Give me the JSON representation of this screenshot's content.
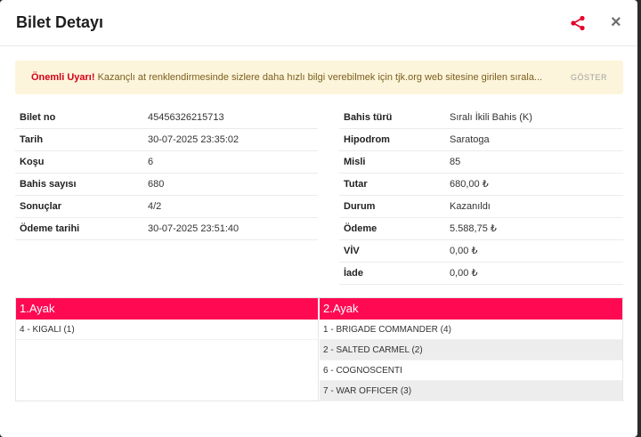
{
  "modal": {
    "title": "Bilet Detayı",
    "share_icon": "share-icon",
    "close_label": "×"
  },
  "warning": {
    "label": "Önemli Uyarı!",
    "text": "Kazançlı at renklendirmesinde sizlere daha hızlı bilgi verebilmek için tjk.org web sitesine girilen sırala...",
    "show_label": "GÖSTER",
    "bg_color": "#fdf5db"
  },
  "left_rows": [
    {
      "key": "Bilet no",
      "value": "45456326215713"
    },
    {
      "key": "Tarih",
      "value": "30-07-2025 23:35:02"
    },
    {
      "key": "Koşu",
      "value": "6"
    },
    {
      "key": "Bahis sayısı",
      "value": "680"
    },
    {
      "key": "Sonuçlar",
      "value": "4/2"
    },
    {
      "key": "Ödeme tarihi",
      "value": "30-07-2025 23:51:40"
    }
  ],
  "right_rows": [
    {
      "key": "Bahis türü",
      "value": "Sıralı İkili Bahis (K)"
    },
    {
      "key": "Hipodrom",
      "value": "Saratoga"
    },
    {
      "key": "Misli",
      "value": "85"
    },
    {
      "key": "Tutar",
      "value": "680,00 ₺"
    },
    {
      "key": "Durum",
      "value": "Kazanıldı"
    },
    {
      "key": "Ödeme",
      "value": "5.588,75 ₺"
    },
    {
      "key": "VİV",
      "value": "0,00 ₺"
    },
    {
      "key": "İade",
      "value": "0,00 ₺"
    }
  ],
  "legs": [
    {
      "title": "1.Ayak",
      "items": [
        "4 - KIGALI (1)"
      ]
    },
    {
      "title": "2.Ayak",
      "items": [
        "1 - BRIGADE COMMANDER (4)",
        "2 - SALTED CARMEL (2)",
        "6 - COGNOSCENTI",
        "7 - WAR OFFICER (3)"
      ]
    }
  ],
  "colors": {
    "accent": "#ff0a52",
    "warning_label": "#d4001a"
  }
}
